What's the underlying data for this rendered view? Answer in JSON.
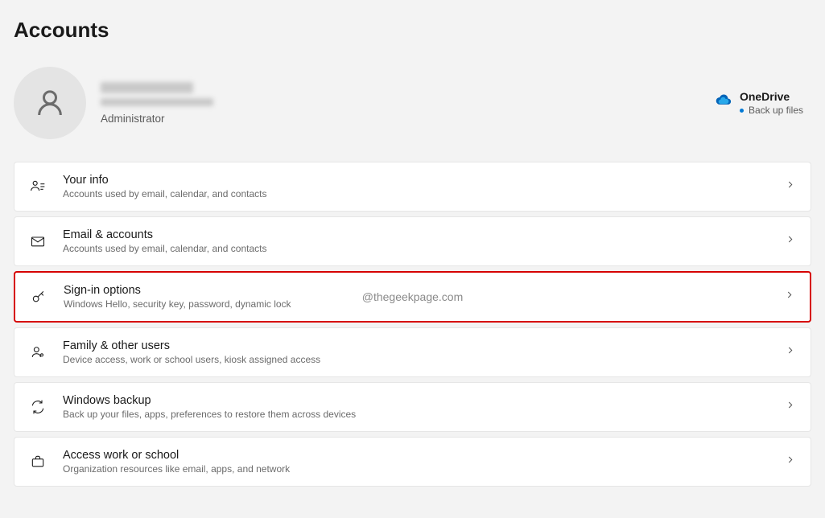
{
  "page": {
    "title": "Accounts"
  },
  "profile": {
    "role": "Administrator"
  },
  "onedrive": {
    "title": "OneDrive",
    "subtitle": "Back up files"
  },
  "items": [
    {
      "id": "your-info",
      "title": "Your info",
      "subtitle": "Accounts used by email, calendar, and contacts"
    },
    {
      "id": "email-accounts",
      "title": "Email & accounts",
      "subtitle": "Accounts used by email, calendar, and contacts"
    },
    {
      "id": "sign-in-options",
      "title": "Sign-in options",
      "subtitle": "Windows Hello, security key, password, dynamic lock",
      "watermark": "@thegeekpage.com"
    },
    {
      "id": "family-other-users",
      "title": "Family & other users",
      "subtitle": "Device access, work or school users, kiosk assigned access"
    },
    {
      "id": "windows-backup",
      "title": "Windows backup",
      "subtitle": "Back up your files, apps, preferences to restore them across devices"
    },
    {
      "id": "access-work-school",
      "title": "Access work or school",
      "subtitle": "Organization resources like email, apps, and network"
    }
  ]
}
